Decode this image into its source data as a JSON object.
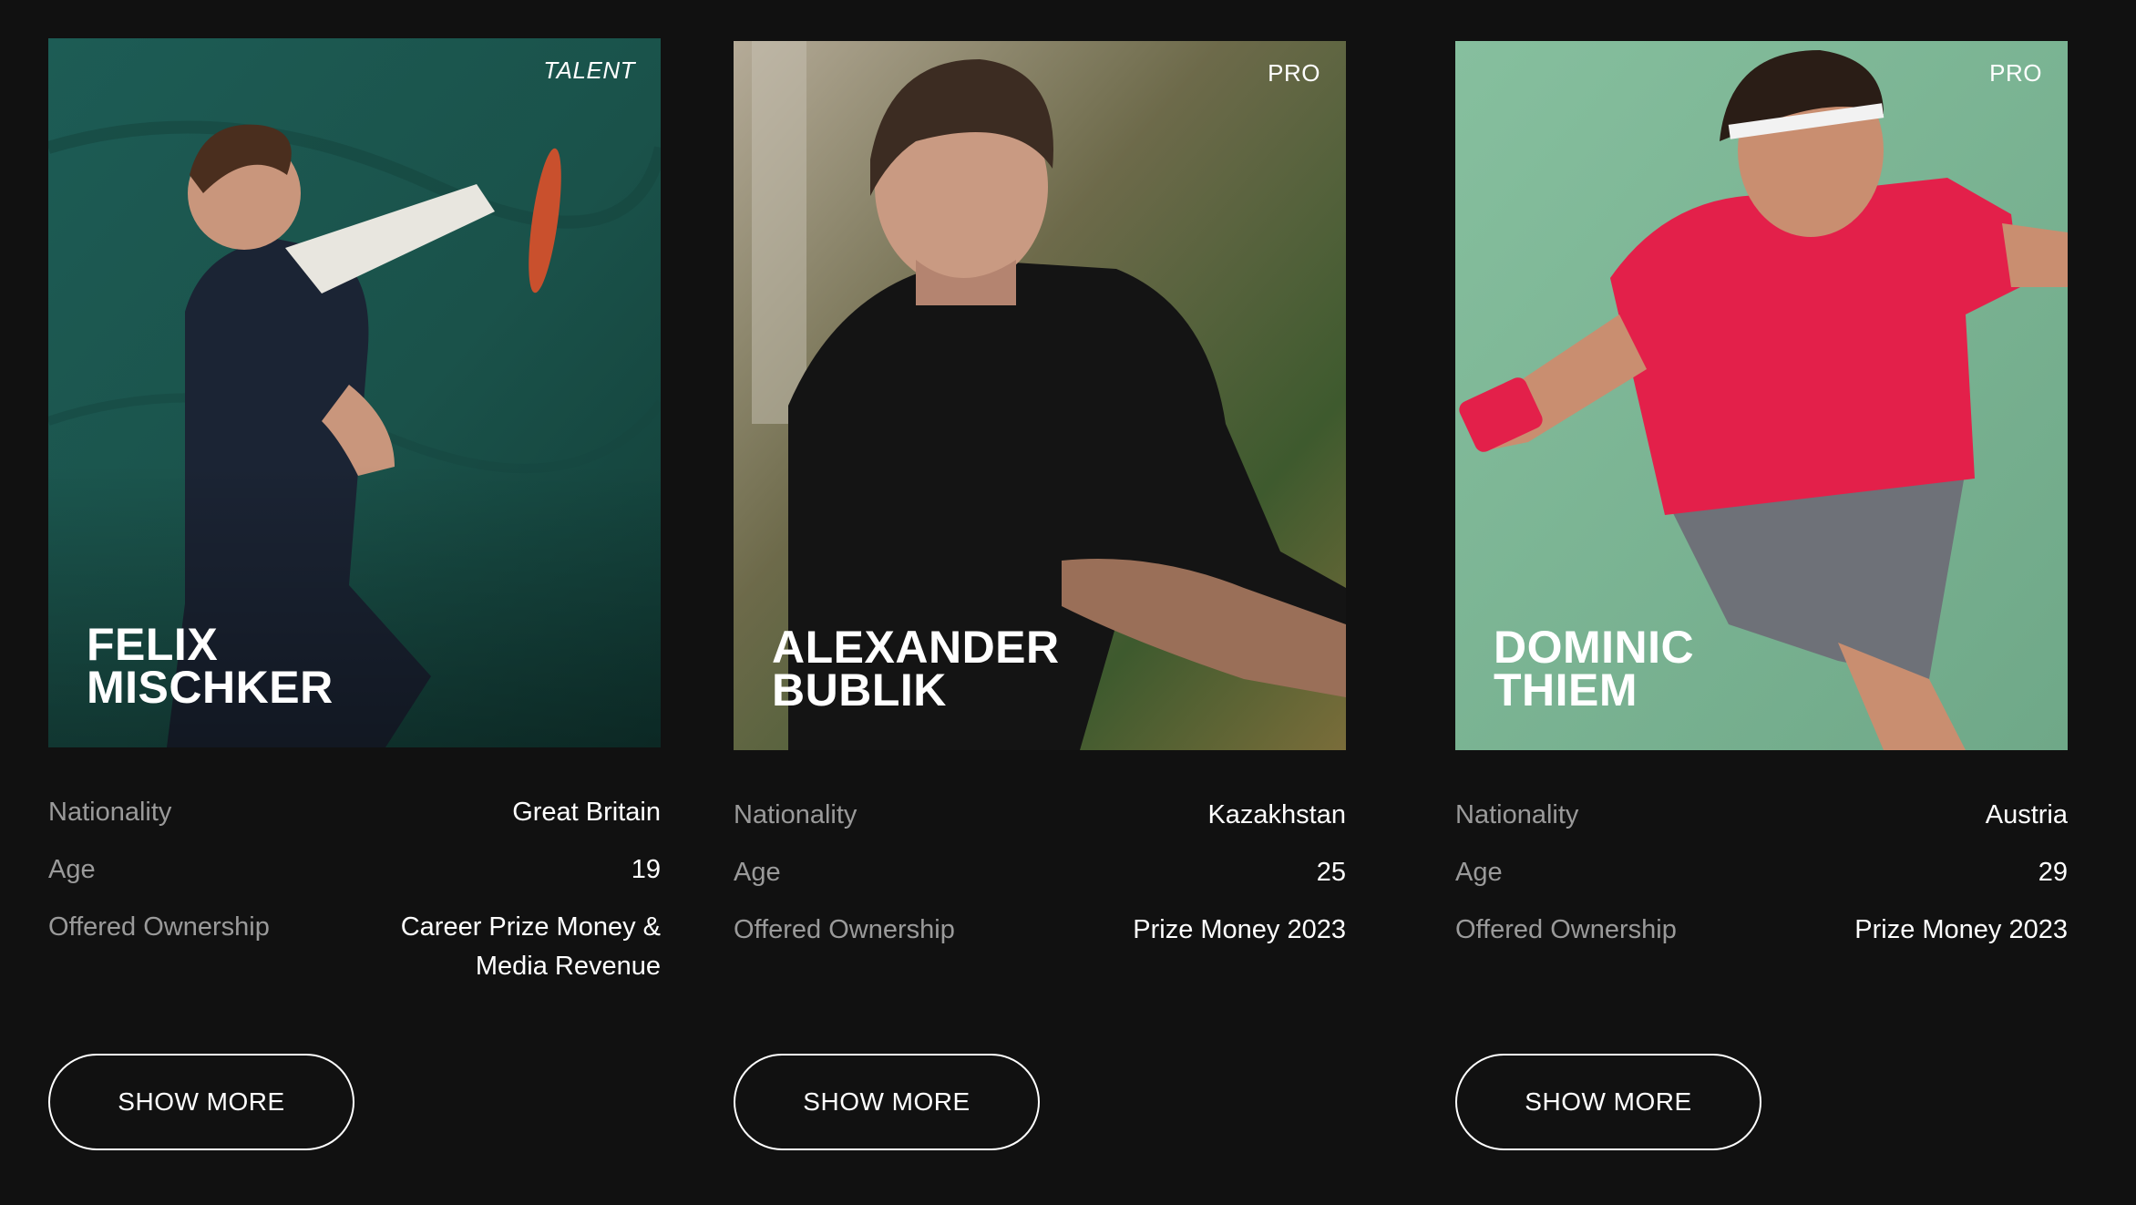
{
  "players": [
    {
      "tier": "TALENT",
      "name_line1": "FELIX",
      "name_line2": "MISCHKER",
      "nationality_label": "Nationality",
      "nationality": "Great Britain",
      "age_label": "Age",
      "age": "19",
      "ownership_label": "Offered Ownership",
      "ownership": "Career Prize Money & Media Revenue",
      "button": "SHOW MORE"
    },
    {
      "tier": "PRO",
      "name_line1": "ALEXANDER",
      "name_line2": "BUBLIK",
      "nationality_label": "Nationality",
      "nationality": "Kazakhstan",
      "age_label": "Age",
      "age": "25",
      "ownership_label": "Offered Ownership",
      "ownership": "Prize Money 2023",
      "button": "SHOW MORE"
    },
    {
      "tier": "PRO",
      "name_line1": "DOMINIC",
      "name_line2": "THIEM",
      "nationality_label": "Nationality",
      "nationality": "Austria",
      "age_label": "Age",
      "age": "29",
      "ownership_label": "Offered Ownership",
      "ownership": "Prize Money 2023",
      "button": "SHOW MORE"
    }
  ],
  "colors": {
    "page_background": "#111111",
    "label_gray": "#9a9a9a",
    "text_white": "#ffffff",
    "photo1_backdrop": "#1f5a52",
    "photo2_backdrop": "#3a4a2c",
    "photo3_backdrop": "#7fb897"
  }
}
